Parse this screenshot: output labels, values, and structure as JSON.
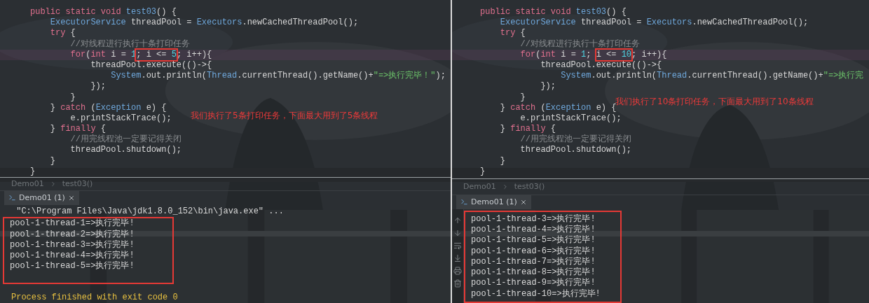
{
  "panes": [
    {
      "code_lines": [
        {
          "tokens": [
            {
              "text": "public static void ",
              "kind": "keyword"
            },
            {
              "text": "test03",
              "kind": "type"
            },
            {
              "text": "() {",
              "kind": "plain"
            }
          ]
        },
        {
          "tokens": [
            {
              "text": "    ExecutorService ",
              "kind": "type"
            },
            {
              "text": "threadPool = ",
              "kind": "plain"
            },
            {
              "text": "Executors",
              "kind": "type"
            },
            {
              "text": ".newCachedThreadPool();",
              "kind": "plain"
            }
          ]
        },
        {
          "tokens": [
            {
              "text": "    try ",
              "kind": "keyword"
            },
            {
              "text": "{",
              "kind": "plain"
            }
          ]
        },
        {
          "tokens": [
            {
              "text": "        //对线程进行执行十条打印任务",
              "kind": "comment"
            }
          ]
        },
        {
          "current": true,
          "tokens": [
            {
              "text": "        for",
              "kind": "keyword"
            },
            {
              "text": "(",
              "kind": "plain"
            },
            {
              "text": "int ",
              "kind": "keyword"
            },
            {
              "text": "i = ",
              "kind": "plain"
            },
            {
              "text": "1",
              "kind": "number"
            },
            {
              "text": "; i <= ",
              "kind": "plain",
              "boxed": true
            },
            {
              "text": "5",
              "kind": "number",
              "boxed": true
            },
            {
              "text": "; i++){",
              "kind": "plain"
            }
          ]
        },
        {
          "tokens": [
            {
              "text": "            threadPool.execute(()->{",
              "kind": "plain"
            }
          ]
        },
        {
          "tokens": [
            {
              "text": "                System",
              "kind": "type"
            },
            {
              "text": ".out.println(",
              "kind": "plain"
            },
            {
              "text": "Thread",
              "kind": "type"
            },
            {
              "text": ".currentThread().getName()+",
              "kind": "plain"
            },
            {
              "text": "\"=>执行完毕！\"",
              "kind": "string"
            },
            {
              "text": ");",
              "kind": "plain"
            }
          ]
        },
        {
          "tokens": [
            {
              "text": "            });",
              "kind": "plain"
            }
          ]
        },
        {
          "tokens": [
            {
              "text": "        }",
              "kind": "plain"
            }
          ]
        },
        {
          "tokens": [
            {
              "text": "    } ",
              "kind": "plain"
            },
            {
              "text": "catch ",
              "kind": "keyword"
            },
            {
              "text": "(",
              "kind": "plain"
            },
            {
              "text": "Exception ",
              "kind": "type"
            },
            {
              "text": "e) {",
              "kind": "plain"
            }
          ]
        },
        {
          "tokens": [
            {
              "text": "        e.printStackTrace();",
              "kind": "plain"
            }
          ]
        },
        {
          "tokens": [
            {
              "text": "    } ",
              "kind": "plain"
            },
            {
              "text": "finally ",
              "kind": "keyword"
            },
            {
              "text": "{",
              "kind": "plain"
            }
          ]
        },
        {
          "tokens": [
            {
              "text": "        //用完线程池一定要记得关闭",
              "kind": "comment"
            }
          ]
        },
        {
          "tokens": [
            {
              "text": "        threadPool.shutdown();",
              "kind": "plain"
            }
          ]
        },
        {
          "tokens": [
            {
              "text": "    }",
              "kind": "plain"
            }
          ]
        },
        {
          "tokens": [
            {
              "text": "}",
              "kind": "plain"
            }
          ]
        }
      ],
      "note": "我们执行了5条打印任务，下面最大用到了5条线程",
      "breadcrumb": [
        "Demo01",
        "test03()"
      ],
      "run_tab": {
        "label": "Demo01 (1)",
        "selected": true
      },
      "console": [
        {
          "text": " \"C:\\Program Files\\Java\\jdk1.8.0_152\\bin\\java.exe\" ...",
          "kind": "output",
          "boxed": false
        },
        {
          "text": "pool-1-thread-1=>执行完毕!",
          "kind": "output",
          "boxed": true
        },
        {
          "text": "pool-1-thread-2=>执行完毕!",
          "kind": "output",
          "boxed": true
        },
        {
          "text": "pool-1-thread-3=>执行完毕!",
          "kind": "output",
          "boxed": true
        },
        {
          "text": "pool-1-thread-4=>执行完毕!",
          "kind": "output",
          "boxed": true
        },
        {
          "text": "pool-1-thread-5=>执行完毕!",
          "kind": "output",
          "boxed": true
        },
        {
          "text": "Process finished with exit code 0",
          "kind": "exit",
          "boxed": false
        }
      ]
    },
    {
      "code_lines": [
        {
          "tokens": [
            {
              "text": "public static void ",
              "kind": "keyword"
            },
            {
              "text": "test03",
              "kind": "type"
            },
            {
              "text": "() {",
              "kind": "plain"
            }
          ]
        },
        {
          "tokens": [
            {
              "text": "    ExecutorService ",
              "kind": "type"
            },
            {
              "text": "threadPool = ",
              "kind": "plain"
            },
            {
              "text": "Executors",
              "kind": "type"
            },
            {
              "text": ".newCachedThreadPool();",
              "kind": "plain"
            }
          ]
        },
        {
          "tokens": [
            {
              "text": "    try ",
              "kind": "keyword"
            },
            {
              "text": "{",
              "kind": "plain"
            }
          ]
        },
        {
          "tokens": [
            {
              "text": "        //对线程进行执行十条打印任务",
              "kind": "comment"
            }
          ]
        },
        {
          "current": true,
          "tokens": [
            {
              "text": "        for",
              "kind": "keyword"
            },
            {
              "text": "(",
              "kind": "plain"
            },
            {
              "text": "int ",
              "kind": "keyword"
            },
            {
              "text": "i = ",
              "kind": "plain"
            },
            {
              "text": "1",
              "kind": "number"
            },
            {
              "text": "; ",
              "kind": "plain"
            },
            {
              "text": "i <= ",
              "kind": "plain",
              "boxed": true
            },
            {
              "text": "10",
              "kind": "number",
              "boxed": true
            },
            {
              "text": "; i++){",
              "kind": "plain"
            }
          ]
        },
        {
          "tokens": [
            {
              "text": "            threadPool.execute(()->{",
              "kind": "plain"
            }
          ]
        },
        {
          "tokens": [
            {
              "text": "                System",
              "kind": "type"
            },
            {
              "text": ".out.println(",
              "kind": "plain"
            },
            {
              "text": "Thread",
              "kind": "type"
            },
            {
              "text": ".currentThread().getName()+",
              "kind": "plain"
            },
            {
              "text": "\"=>执行完",
              "kind": "string"
            }
          ]
        },
        {
          "tokens": [
            {
              "text": "            });",
              "kind": "plain"
            }
          ]
        },
        {
          "tokens": [
            {
              "text": "        }",
              "kind": "plain"
            }
          ]
        },
        {
          "tokens": [
            {
              "text": "    } ",
              "kind": "plain"
            },
            {
              "text": "catch ",
              "kind": "keyword"
            },
            {
              "text": "(",
              "kind": "plain"
            },
            {
              "text": "Exception ",
              "kind": "type"
            },
            {
              "text": "e) {",
              "kind": "plain"
            }
          ]
        },
        {
          "tokens": [
            {
              "text": "        e.printStackTrace();",
              "kind": "plain"
            }
          ]
        },
        {
          "tokens": [
            {
              "text": "    } ",
              "kind": "plain"
            },
            {
              "text": "finally ",
              "kind": "keyword"
            },
            {
              "text": "{",
              "kind": "plain"
            }
          ]
        },
        {
          "tokens": [
            {
              "text": "        //用完线程池一定要记得关闭",
              "kind": "comment"
            }
          ]
        },
        {
          "tokens": [
            {
              "text": "        threadPool.shutdown();",
              "kind": "plain"
            }
          ]
        },
        {
          "tokens": [
            {
              "text": "    }",
              "kind": "plain"
            }
          ]
        },
        {
          "tokens": [
            {
              "text": "}",
              "kind": "plain"
            }
          ]
        }
      ],
      "note": "我们执行了10条打印任务，下面最大用到了10条线程",
      "breadcrumb": [
        "Demo01",
        "test03()"
      ],
      "run_tab": {
        "label": "Demo01 (1)",
        "selected": true
      },
      "console": [
        {
          "text": "pool-1-thread-3=>执行完毕!",
          "kind": "output",
          "boxed": true
        },
        {
          "text": "pool-1-thread-4=>执行完毕!",
          "kind": "output",
          "boxed": true
        },
        {
          "text": "pool-1-thread-5=>执行完毕!",
          "kind": "output",
          "boxed": true
        },
        {
          "text": "pool-1-thread-6=>执行完毕!",
          "kind": "output",
          "boxed": true
        },
        {
          "text": "pool-1-thread-7=>执行完毕!",
          "kind": "output",
          "boxed": true
        },
        {
          "text": "pool-1-thread-8=>执行完毕!",
          "kind": "output",
          "boxed": true
        },
        {
          "text": "pool-1-thread-9=>执行完毕!",
          "kind": "output",
          "boxed": true
        },
        {
          "text": "pool-1-thread-10=>执行完毕!",
          "kind": "output",
          "boxed": true
        }
      ],
      "console_tools": true
    }
  ]
}
